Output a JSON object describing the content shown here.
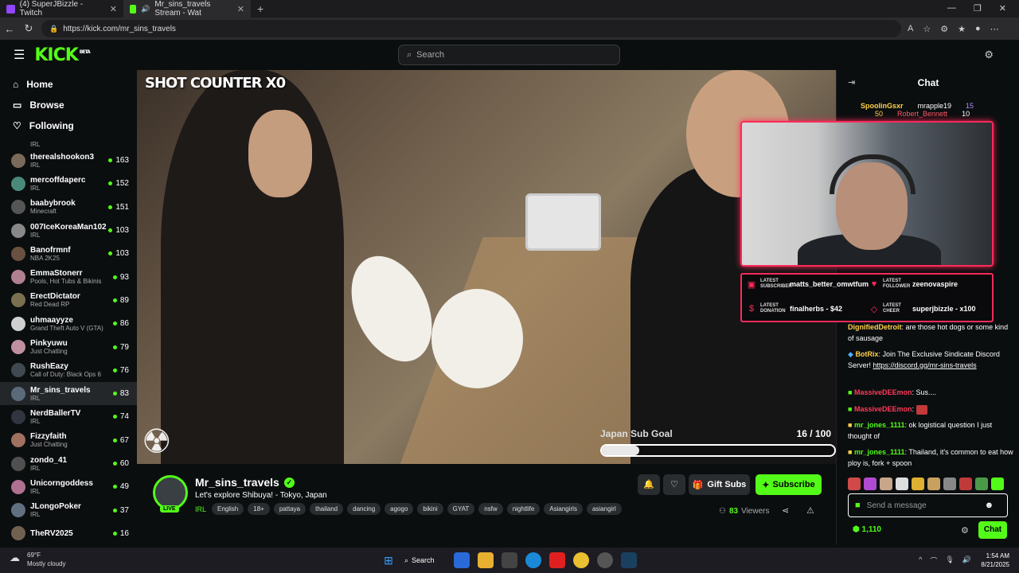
{
  "browser": {
    "tabs": [
      {
        "title": "(4) SuperJBizzle - Twitch",
        "color": "#9146ff"
      },
      {
        "title": "Mr_sins_travels Stream - Wat",
        "color": "#53fc18"
      }
    ],
    "new_tab": "+",
    "url": "https://kick.com/mr_sins_travels"
  },
  "header": {
    "logo": "KICK",
    "logo_sup": "BETA",
    "search_placeholder": "Search"
  },
  "sidebar": {
    "nav": [
      {
        "label": "Home",
        "icon": "⌂"
      },
      {
        "label": "Browse",
        "icon": "▭"
      },
      {
        "label": "Following",
        "icon": "♡"
      }
    ],
    "partial_top_category": "IRL",
    "channels": [
      {
        "name": "therealshookon3",
        "category": "IRL",
        "viewers": "163",
        "color": "#7a6a5a"
      },
      {
        "name": "mercoffdaperc",
        "category": "IRL",
        "viewers": "152",
        "color": "#4a8a7a"
      },
      {
        "name": "baabybrook",
        "category": "Minecraft",
        "viewers": "151",
        "color": "#555"
      },
      {
        "name": "007IceKoreaMan102",
        "category": "IRL",
        "viewers": "103",
        "color": "#888"
      },
      {
        "name": "Banofrmnf",
        "category": "NBA 2K25",
        "viewers": "103",
        "color": "#6a5040"
      },
      {
        "name": "EmmaStonerr",
        "category": "Pools, Hot Tubs & Bikinis",
        "viewers": "93",
        "color": "#b08090"
      },
      {
        "name": "ErectDictator",
        "category": "Red Dead RP",
        "viewers": "89",
        "color": "#7a7050"
      },
      {
        "name": "uhmaayyze",
        "category": "Grand Theft Auto V (GTA)",
        "viewers": "86",
        "color": "#d0d0d0"
      },
      {
        "name": "Pinkyuwu",
        "category": "Just Chatting",
        "viewers": "79",
        "color": "#c090a0"
      },
      {
        "name": "RushEazy",
        "category": "Call of Duty: Black Ops 6",
        "viewers": "76",
        "color": "#404850"
      },
      {
        "name": "Mr_sins_travels",
        "category": "IRL",
        "viewers": "83",
        "color": "#5a6a7a"
      },
      {
        "name": "NerdBallerTV",
        "category": "IRL",
        "viewers": "74",
        "color": "#303540"
      },
      {
        "name": "Fizzyfaith",
        "category": "Just Chatting",
        "viewers": "67",
        "color": "#a07060"
      },
      {
        "name": "zondo_41",
        "category": "IRL",
        "viewers": "60",
        "color": "#505050"
      },
      {
        "name": "Unicorngoddess",
        "category": "IRL",
        "viewers": "49",
        "color": "#b07090"
      },
      {
        "name": "JLongoPoker",
        "category": "IRL",
        "viewers": "37",
        "color": "#607080"
      },
      {
        "name": "TheRV2025",
        "category": "",
        "viewers": "16",
        "color": "#706050"
      }
    ]
  },
  "player": {
    "shot_counter": "SHOT COUNTER",
    "shot_value": "X0",
    "subgoal_label": "Japan Sub Goal",
    "subgoal_count": "16 / 100",
    "subgoal_progress": 0.16,
    "overlay_top_users": [
      {
        "name": "SpoolinGsxr",
        "value": "50"
      },
      {
        "name": "mrapple19",
        "value": "15"
      },
      {
        "name": "Robert_Bennett",
        "value": "10"
      }
    ],
    "alerts": {
      "latest_subscriber_label": "LATEST SUBSCRIBER",
      "latest_subscriber": "matts_better_omwtfum",
      "latest_follower_label": "LATEST FOLLOWER",
      "latest_follower": "zeenovaspire",
      "latest_donation_label": "LATEST DONATION",
      "latest_donation": "finalherbs - $42",
      "latest_cheer_label": "LATEST CHEER",
      "latest_cheer": "superjbizzle - x100"
    }
  },
  "stream_info": {
    "channel_name": "Mr_sins_travels",
    "live_badge": "LIVE",
    "title": "Let's explore Shibuya! - Tokyo, Japan",
    "category": "IRL",
    "tags": [
      "English",
      "18+",
      "pattaya",
      "thailand",
      "dancing",
      "agogo",
      "bikini",
      "GYAT",
      "nsfw",
      "nightlife",
      "Asiangirls",
      "asiangirl"
    ],
    "gift_subs_label": "Gift Subs",
    "subscribe_label": "Subscribe",
    "viewers_count": "83",
    "viewers_label": "Viewers"
  },
  "chat": {
    "title": "Chat",
    "messages": [
      {
        "user": "DignifiedDetroit",
        "user_color": "#ffd24a",
        "text": "are those hot dogs or some kind of sausage"
      },
      {
        "user": "BotRix",
        "user_color": "#ffd24a",
        "text": "Join The Exclusive Sindicate Discord Server!",
        "link": "https://discord.gg/mr-sins-travels"
      },
      {
        "user": "MassiveDEEmon",
        "user_color": "#ff3a5a",
        "text": "Sus...."
      },
      {
        "user": "MassiveDEEmon",
        "user_color": "#ff3a5a",
        "text": ""
      },
      {
        "user": "mr_jones_1111",
        "user_color": "#53fc18",
        "text": "ok logistical question I just thought of"
      },
      {
        "user": "mr_jones_1111",
        "user_color": "#53fc18",
        "text": "Thailand, it's common to eat how ploy is, fork + spoon"
      }
    ],
    "input_placeholder": "Send a message",
    "points": "1,110",
    "send_label": "Chat"
  },
  "taskbar": {
    "temp": "69°F",
    "weather": "Mostly cloudy",
    "search_label": "Search",
    "time": "1:54 AM",
    "date": "8/21/2025"
  }
}
